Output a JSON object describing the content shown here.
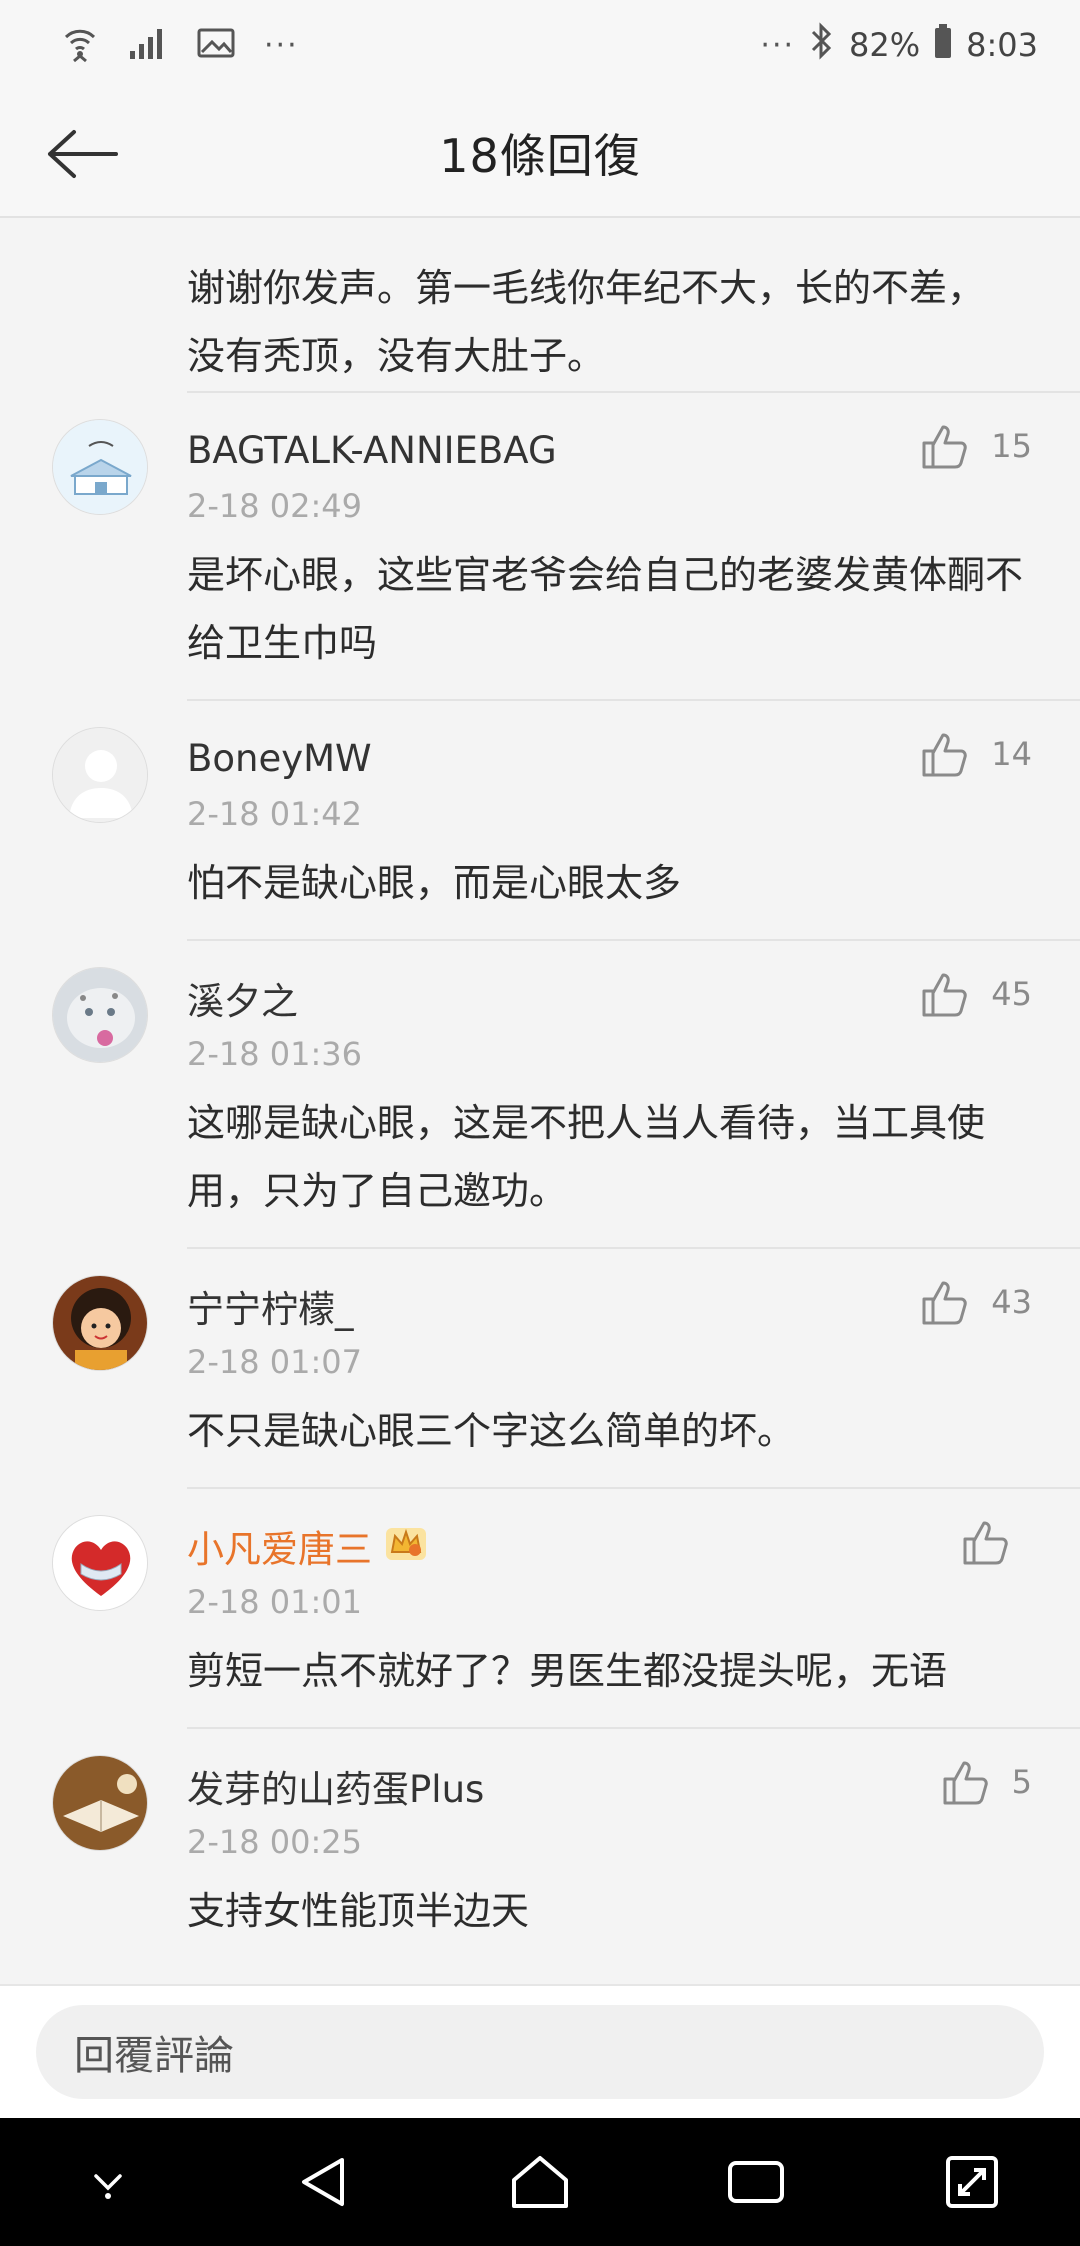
{
  "status_bar": {
    "left_dots": "···",
    "right_dots": "···",
    "battery": "82%",
    "time": "8:03"
  },
  "header": {
    "title": "18條回復"
  },
  "first_comment_tail": "谢谢你发声。第一毛线你年纪不大，长的不差，没有秃顶，没有大肚子。",
  "comments": [
    {
      "name": "BAGTALK-ANNIEBAG",
      "time": "2-18 02:49",
      "likes": "15",
      "text": "是坏心眼，这些官老爷会给自己的老婆发黄体酮不给卫生巾吗"
    },
    {
      "name": "BoneyMW",
      "time": "2-18 01:42",
      "likes": "14",
      "text": "怕不是缺心眼，而是心眼太多"
    },
    {
      "name": "溪夕之",
      "time": "2-18 01:36",
      "likes": "45",
      "text": "这哪是缺心眼，这是不把人当人看待，当工具使用，只为了自己邀功。"
    },
    {
      "name": "宁宁柠檬_",
      "time": "2-18 01:07",
      "likes": "43",
      "text": "不只是缺心眼三个字这么简单的坏。"
    },
    {
      "name": "小凡爱唐三",
      "time": "2-18 01:01",
      "likes": "",
      "text": "剪短一点不就好了？男医生都没提头呢，无语"
    },
    {
      "name": "发芽的山药蛋Plus",
      "time": "2-18 00:25",
      "likes": "5",
      "text": "支持女性能顶半边天"
    }
  ],
  "reply_bar": {
    "placeholder": "回覆評論"
  },
  "colors": {
    "highlight_name": "#e8742a",
    "crown": "#f2b632"
  }
}
